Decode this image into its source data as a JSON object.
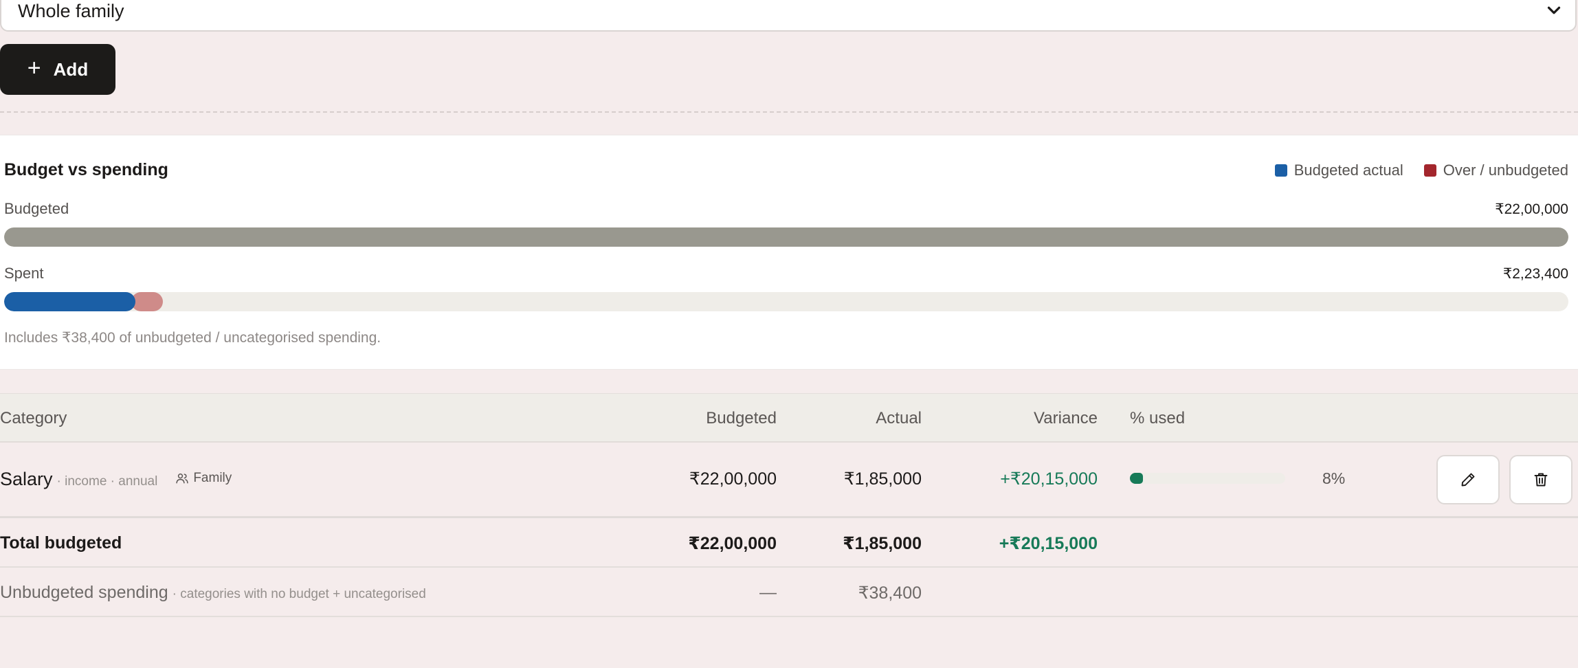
{
  "filter": {
    "selected": "Whole family"
  },
  "add_button": {
    "label": "Add"
  },
  "budget_card": {
    "title": "Budget vs spending",
    "legend": [
      {
        "label": "Budgeted actual",
        "color": "#1b5fa6"
      },
      {
        "label": "Over / unbudgeted",
        "color": "#a3262d"
      }
    ],
    "budgeted": {
      "label": "Budgeted",
      "value": "₹22,00,000",
      "fraction": 1.0,
      "color": "#99988f"
    },
    "spent": {
      "label": "Spent",
      "value": "₹2,23,400",
      "budgeted_fraction": 0.0841,
      "over_fraction": 0.0175,
      "budgeted_color": "#1b5fa6",
      "over_color": "#cf8b89"
    },
    "note": "Includes ₹38,400 of unbudgeted / uncategorised spending."
  },
  "table": {
    "headers": {
      "category": "Category",
      "budgeted": "Budgeted",
      "actual": "Actual",
      "variance": "Variance",
      "used": "% used"
    },
    "rows": [
      {
        "name": "Salary",
        "meta": "· income · annual",
        "scope": "Family",
        "budgeted": "₹22,00,000",
        "actual": "₹1,85,000",
        "variance": "+₹20,15,000",
        "used_pct": "8%",
        "used_fraction": 0.084
      }
    ],
    "total": {
      "label": "Total budgeted",
      "budgeted": "₹22,00,000",
      "actual": "₹1,85,000",
      "variance": "+₹20,15,000"
    },
    "unbudgeted": {
      "label": "Unbudgeted spending",
      "meta": "· categories with no budget + uncategorised",
      "budgeted": "—",
      "actual": "₹38,400"
    }
  },
  "icons": {
    "chevron": "chevron-down-icon",
    "plus": "plus-icon",
    "users": "users-icon",
    "edit": "pencil-icon",
    "delete": "trash-icon"
  }
}
